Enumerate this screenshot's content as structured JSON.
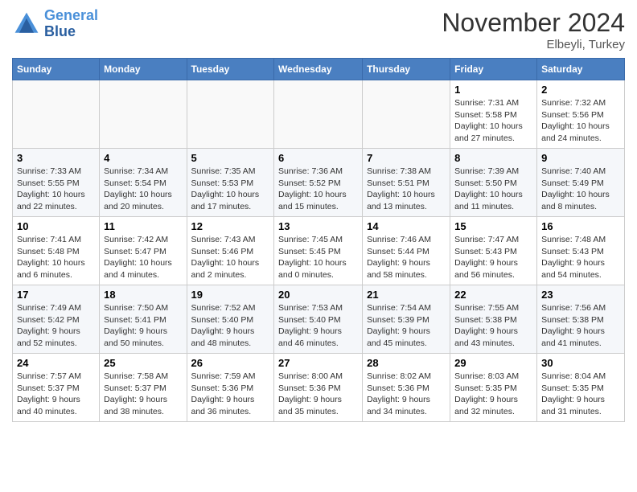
{
  "header": {
    "logo_line1": "General",
    "logo_line2": "Blue",
    "month": "November 2024",
    "location": "Elbeyli, Turkey"
  },
  "weekdays": [
    "Sunday",
    "Monday",
    "Tuesday",
    "Wednesday",
    "Thursday",
    "Friday",
    "Saturday"
  ],
  "weeks": [
    [
      {
        "day": "",
        "info": ""
      },
      {
        "day": "",
        "info": ""
      },
      {
        "day": "",
        "info": ""
      },
      {
        "day": "",
        "info": ""
      },
      {
        "day": "",
        "info": ""
      },
      {
        "day": "1",
        "info": "Sunrise: 7:31 AM\nSunset: 5:58 PM\nDaylight: 10 hours and 27 minutes."
      },
      {
        "day": "2",
        "info": "Sunrise: 7:32 AM\nSunset: 5:56 PM\nDaylight: 10 hours and 24 minutes."
      }
    ],
    [
      {
        "day": "3",
        "info": "Sunrise: 7:33 AM\nSunset: 5:55 PM\nDaylight: 10 hours and 22 minutes."
      },
      {
        "day": "4",
        "info": "Sunrise: 7:34 AM\nSunset: 5:54 PM\nDaylight: 10 hours and 20 minutes."
      },
      {
        "day": "5",
        "info": "Sunrise: 7:35 AM\nSunset: 5:53 PM\nDaylight: 10 hours and 17 minutes."
      },
      {
        "day": "6",
        "info": "Sunrise: 7:36 AM\nSunset: 5:52 PM\nDaylight: 10 hours and 15 minutes."
      },
      {
        "day": "7",
        "info": "Sunrise: 7:38 AM\nSunset: 5:51 PM\nDaylight: 10 hours and 13 minutes."
      },
      {
        "day": "8",
        "info": "Sunrise: 7:39 AM\nSunset: 5:50 PM\nDaylight: 10 hours and 11 minutes."
      },
      {
        "day": "9",
        "info": "Sunrise: 7:40 AM\nSunset: 5:49 PM\nDaylight: 10 hours and 8 minutes."
      }
    ],
    [
      {
        "day": "10",
        "info": "Sunrise: 7:41 AM\nSunset: 5:48 PM\nDaylight: 10 hours and 6 minutes."
      },
      {
        "day": "11",
        "info": "Sunrise: 7:42 AM\nSunset: 5:47 PM\nDaylight: 10 hours and 4 minutes."
      },
      {
        "day": "12",
        "info": "Sunrise: 7:43 AM\nSunset: 5:46 PM\nDaylight: 10 hours and 2 minutes."
      },
      {
        "day": "13",
        "info": "Sunrise: 7:45 AM\nSunset: 5:45 PM\nDaylight: 10 hours and 0 minutes."
      },
      {
        "day": "14",
        "info": "Sunrise: 7:46 AM\nSunset: 5:44 PM\nDaylight: 9 hours and 58 minutes."
      },
      {
        "day": "15",
        "info": "Sunrise: 7:47 AM\nSunset: 5:43 PM\nDaylight: 9 hours and 56 minutes."
      },
      {
        "day": "16",
        "info": "Sunrise: 7:48 AM\nSunset: 5:43 PM\nDaylight: 9 hours and 54 minutes."
      }
    ],
    [
      {
        "day": "17",
        "info": "Sunrise: 7:49 AM\nSunset: 5:42 PM\nDaylight: 9 hours and 52 minutes."
      },
      {
        "day": "18",
        "info": "Sunrise: 7:50 AM\nSunset: 5:41 PM\nDaylight: 9 hours and 50 minutes."
      },
      {
        "day": "19",
        "info": "Sunrise: 7:52 AM\nSunset: 5:40 PM\nDaylight: 9 hours and 48 minutes."
      },
      {
        "day": "20",
        "info": "Sunrise: 7:53 AM\nSunset: 5:40 PM\nDaylight: 9 hours and 46 minutes."
      },
      {
        "day": "21",
        "info": "Sunrise: 7:54 AM\nSunset: 5:39 PM\nDaylight: 9 hours and 45 minutes."
      },
      {
        "day": "22",
        "info": "Sunrise: 7:55 AM\nSunset: 5:38 PM\nDaylight: 9 hours and 43 minutes."
      },
      {
        "day": "23",
        "info": "Sunrise: 7:56 AM\nSunset: 5:38 PM\nDaylight: 9 hours and 41 minutes."
      }
    ],
    [
      {
        "day": "24",
        "info": "Sunrise: 7:57 AM\nSunset: 5:37 PM\nDaylight: 9 hours and 40 minutes."
      },
      {
        "day": "25",
        "info": "Sunrise: 7:58 AM\nSunset: 5:37 PM\nDaylight: 9 hours and 38 minutes."
      },
      {
        "day": "26",
        "info": "Sunrise: 7:59 AM\nSunset: 5:36 PM\nDaylight: 9 hours and 36 minutes."
      },
      {
        "day": "27",
        "info": "Sunrise: 8:00 AM\nSunset: 5:36 PM\nDaylight: 9 hours and 35 minutes."
      },
      {
        "day": "28",
        "info": "Sunrise: 8:02 AM\nSunset: 5:36 PM\nDaylight: 9 hours and 34 minutes."
      },
      {
        "day": "29",
        "info": "Sunrise: 8:03 AM\nSunset: 5:35 PM\nDaylight: 9 hours and 32 minutes."
      },
      {
        "day": "30",
        "info": "Sunrise: 8:04 AM\nSunset: 5:35 PM\nDaylight: 9 hours and 31 minutes."
      }
    ]
  ]
}
